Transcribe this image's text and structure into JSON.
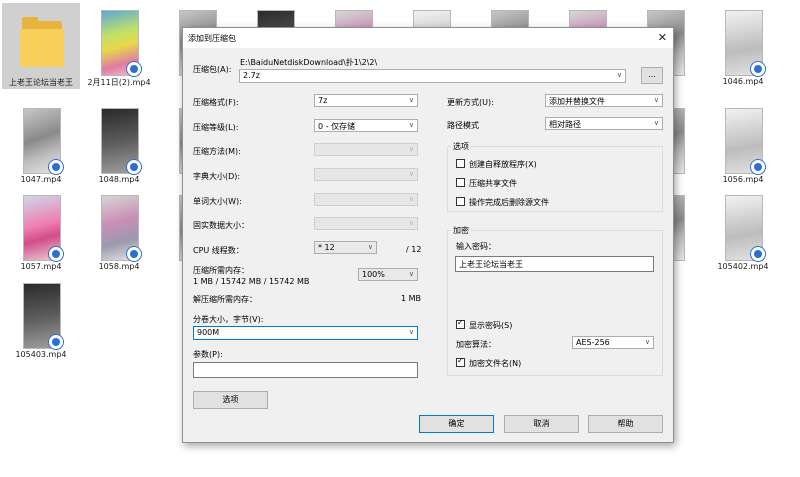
{
  "files": [
    {
      "name": "上老王论坛当老王",
      "type": "folder"
    },
    {
      "name": "2月11日(2).mp4",
      "type": "video",
      "tone": "green"
    },
    {
      "name": "1046.mp4",
      "type": "video",
      "tone": "white"
    },
    {
      "name": "1047.mp4",
      "type": "video",
      "tone": "gray"
    },
    {
      "name": "1048.mp4",
      "type": "video",
      "tone": "dark"
    },
    {
      "name": "1056.mp4",
      "type": "video",
      "tone": "gray"
    },
    {
      "name": "1057.mp4",
      "type": "video",
      "tone": "pinkgirl"
    },
    {
      "name": "1058.mp4",
      "type": "video",
      "tone": "pink"
    },
    {
      "name": "105402.mp4",
      "type": "video",
      "tone": "white"
    },
    {
      "name": "105403.mp4",
      "type": "video",
      "tone": "dark"
    }
  ],
  "dialog": {
    "title": "添加到压缩包",
    "archive_label": "压缩包(A):",
    "archive_path": "E:\\BaiduNetdiskDownload\\扑1\\2\\2\\",
    "archive_name": "2.7z",
    "browse_label": "...",
    "left": {
      "format_label": "压缩格式(F):",
      "format_value": "7z",
      "level_label": "压缩等级(L):",
      "level_value": "0 - 仅存储",
      "method_label": "压缩方法(M):",
      "dict_label": "字典大小(D):",
      "word_label": "单词大小(W):",
      "solid_label": "固实数据大小：",
      "cpu_label": "CPU 线程数：",
      "cpu_value": "* 12",
      "cpu_total": "/ 12",
      "mem_comp_label": "压缩所需内存：",
      "mem_comp_value": "1 MB / 15742 MB / 15742 MB",
      "mem_percent": "100%",
      "mem_decomp_label": "解压缩所需内存：",
      "mem_decomp_value": "1 MB",
      "split_label": "分卷大小，字节(V):",
      "split_value": "900M",
      "params_label": "参数(P):",
      "params_value": "",
      "options_button": "选项"
    },
    "right": {
      "update_label": "更新方式(U):",
      "update_value": "添加并替换文件",
      "path_label": "路径模式",
      "path_value": "相对路径",
      "options_group": "选项",
      "opt_sfx": "创建自释放程序(X)",
      "opt_shared": "压缩共享文件",
      "opt_delete": "操作完成后删除源文件",
      "encrypt_group": "加密",
      "password_label": "输入密码：",
      "password_value": "上老王论坛当老王",
      "show_password": "显示密码(S)",
      "enc_method_label": "加密算法：",
      "enc_method_value": "AES-256",
      "encrypt_names": "加密文件名(N)"
    },
    "ok_button": "确定",
    "cancel_button": "取消",
    "help_button": "帮助"
  }
}
